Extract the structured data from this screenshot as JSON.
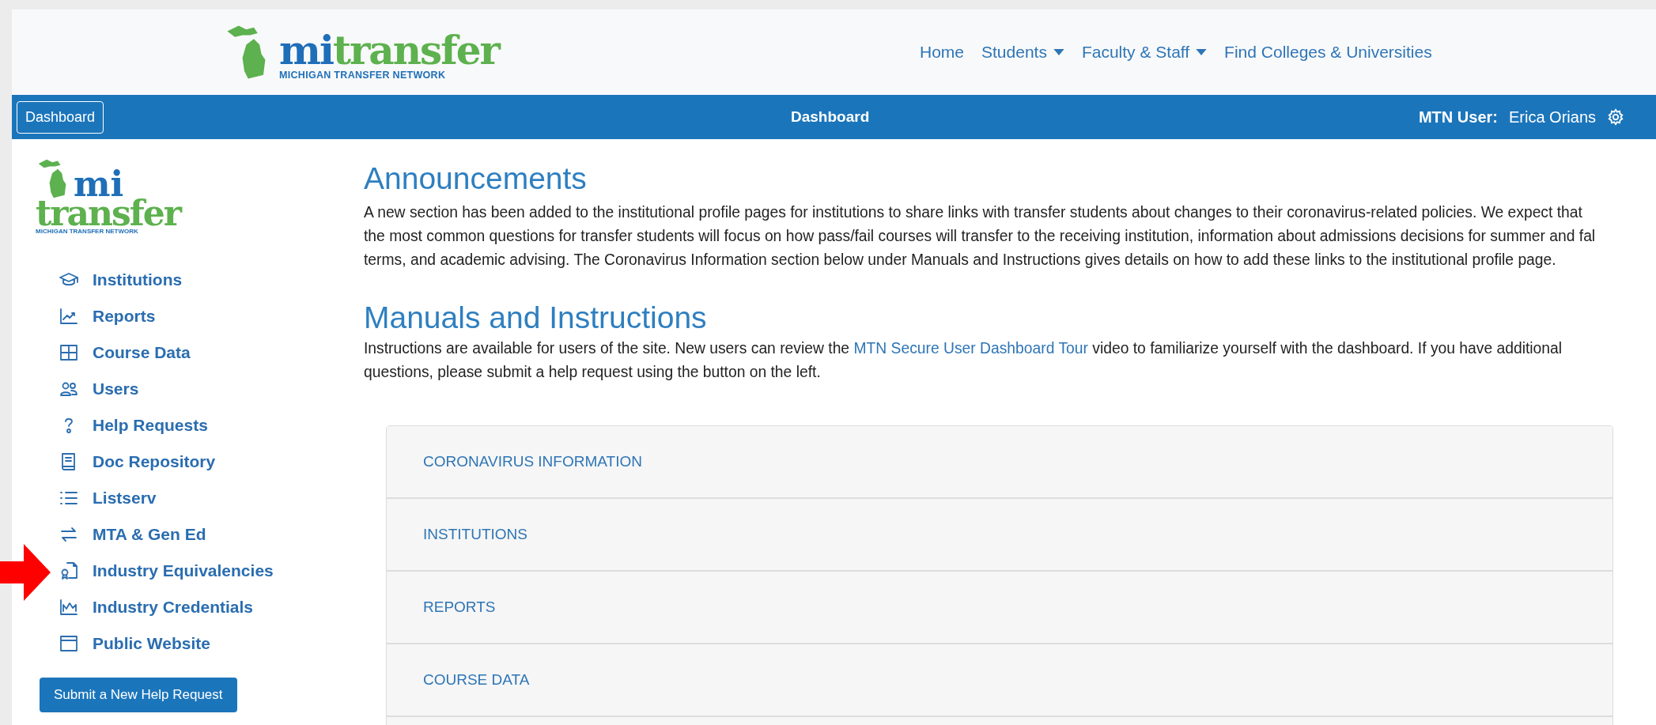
{
  "header": {
    "logo": {
      "brand_a": "mi",
      "brand_b": "transfer",
      "tagline": "MICHIGAN TRANSFER NETWORK"
    },
    "nav": [
      {
        "label": "Home",
        "dropdown": false
      },
      {
        "label": "Students",
        "dropdown": true
      },
      {
        "label": "Faculty & Staff",
        "dropdown": true
      },
      {
        "label": "Find Colleges & Universities",
        "dropdown": false
      }
    ]
  },
  "toolbar": {
    "button": "Dashboard",
    "title": "Dashboard",
    "user_label": "MTN User:",
    "user_name": "Erica Orians"
  },
  "sidebar": {
    "logo": {
      "brand_a": "mi",
      "brand_b": "transfer",
      "tagline": "MICHIGAN TRANSFER NETWORK"
    },
    "items": [
      {
        "label": "Institutions",
        "kind": "cap",
        "pointed": false
      },
      {
        "label": "Reports",
        "kind": "chart",
        "pointed": false
      },
      {
        "label": "Course Data",
        "kind": "grid",
        "pointed": false
      },
      {
        "label": "Users",
        "kind": "users",
        "pointed": false
      },
      {
        "label": "Help Requests",
        "kind": "question",
        "pointed": false
      },
      {
        "label": "Doc Repository",
        "kind": "book",
        "pointed": false
      },
      {
        "label": "Listserv",
        "kind": "list",
        "pointed": false
      },
      {
        "label": "MTA & Gen Ed",
        "kind": "arrows",
        "pointed": false
      },
      {
        "label": "Industry Equivalencies",
        "kind": "certificate",
        "pointed": true
      },
      {
        "label": "Industry Credentials",
        "kind": "area",
        "pointed": false
      },
      {
        "label": "Public Website",
        "kind": "window",
        "pointed": false
      }
    ],
    "button": "Submit a New Help Request"
  },
  "announcements": {
    "title": "Announcements",
    "lines": [
      "A new section has been added to the institutional profile pages for institutions to share links with transfer students about changes to their coronavirus-related policies.  We expect that",
      "the most common questions for transfer students will focus on how pass/fail courses will transfer to the receiving institution, information about admissions decisions for summer and fal",
      "terms, and academic advising.  The Coronavirus Information section below under Manuals and Instructions gives details on how to add these links to the institutional profile page."
    ]
  },
  "manuals": {
    "title": "Manuals and Instructions",
    "before": "Instructions are available for users of the site.  New users can review the",
    "link": "MTN Secure User Dashboard Tour",
    "after": "video to familiarize yourself with the dashboard.  If you have additional",
    "second_line": "questions, please submit a help request using the button on the left."
  },
  "accordion": [
    "CORONAVIRUS INFORMATION",
    "INSTITUTIONS",
    "REPORTS",
    "COURSE DATA"
  ]
}
